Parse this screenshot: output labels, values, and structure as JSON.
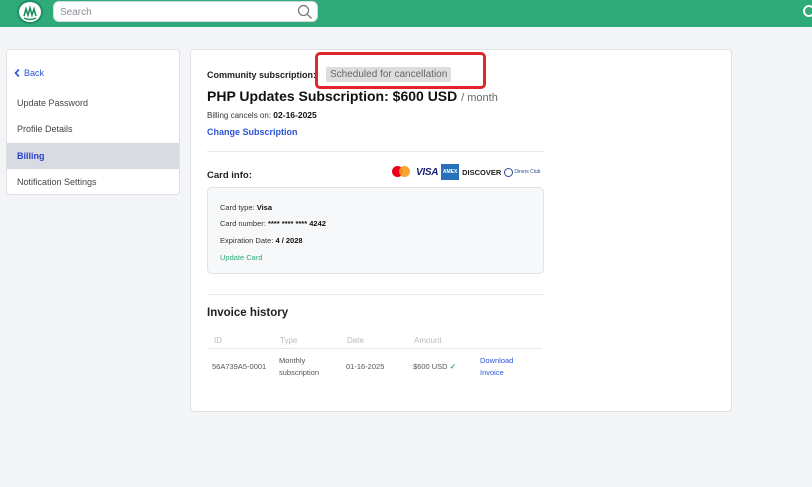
{
  "header": {
    "search_placeholder": "Search"
  },
  "sidebar": {
    "back_label": "Back",
    "items": [
      {
        "label": "Update Password",
        "active": false
      },
      {
        "label": "Profile Details",
        "active": false
      },
      {
        "label": "Billing",
        "active": true
      },
      {
        "label": "Notification Settings",
        "active": false
      }
    ]
  },
  "subscription": {
    "label": "Community subscription:",
    "status": "Scheduled for cancellation",
    "plan_title": "PHP Updates Subscription: $600 USD",
    "plan_period": "/ month",
    "billing_label": "Billing cancels on:",
    "billing_date": "02-16-2025",
    "change_label": "Change Subscription"
  },
  "card": {
    "label": "Card info:",
    "logos": [
      "mastercard",
      "VISA",
      "AMERICAN EXPRESS",
      "DISCOVER",
      "Diners Club"
    ],
    "type_label": "Card type:",
    "type_value": "Visa",
    "number_label": "Card number:",
    "number_value": "**** **** **** 4242",
    "exp_label": "Expiration Date:",
    "exp_value": "4 / 2028",
    "update_label": "Update Card"
  },
  "invoices": {
    "title": "Invoice history",
    "columns": [
      "ID",
      "Type",
      "Date",
      "Amount"
    ],
    "rows": [
      {
        "id": "56A739A5-0001",
        "type_line1": "Monthly",
        "type_line2": "subscription",
        "date": "01-16-2025",
        "amount": "$600 USD",
        "download_line1": "Download",
        "download_line2": "Invoice"
      }
    ]
  },
  "colors": {
    "brand": "#2eab79",
    "link": "#2b55d6",
    "highlight": "#e0262b"
  }
}
